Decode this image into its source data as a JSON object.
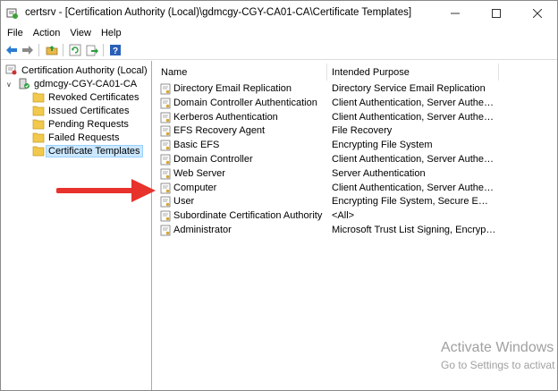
{
  "window": {
    "title": "certsrv - [Certification Authority (Local)\\gdmcgy-CGY-CA01-CA\\Certificate Templates]"
  },
  "menu": [
    {
      "label": "File"
    },
    {
      "label": "Action"
    },
    {
      "label": "View"
    },
    {
      "label": "Help"
    }
  ],
  "tree": {
    "root": "Certification Authority (Local)",
    "ca": "gdmcgy-CGY-CA01-CA",
    "children": [
      {
        "label": "Revoked Certificates"
      },
      {
        "label": "Issued Certificates"
      },
      {
        "label": "Pending Requests"
      },
      {
        "label": "Failed Requests"
      },
      {
        "label": "Certificate Templates",
        "selected": true
      }
    ]
  },
  "list": {
    "columns": [
      "Name",
      "Intended Purpose"
    ],
    "rows": [
      {
        "name": "Directory Email Replication",
        "purpose": "Directory Service Email Replication"
      },
      {
        "name": "Domain Controller Authentication",
        "purpose": "Client Authentication, Server Authentic..."
      },
      {
        "name": "Kerberos Authentication",
        "purpose": "Client Authentication, Server Authentic..."
      },
      {
        "name": "EFS Recovery Agent",
        "purpose": "File Recovery"
      },
      {
        "name": "Basic EFS",
        "purpose": "Encrypting File System"
      },
      {
        "name": "Domain Controller",
        "purpose": "Client Authentication, Server Authentic..."
      },
      {
        "name": "Web Server",
        "purpose": "Server Authentication"
      },
      {
        "name": "Computer",
        "purpose": "Client Authentication, Server Authentic..."
      },
      {
        "name": "User",
        "purpose": "Encrypting File System, Secure Email, Cl..."
      },
      {
        "name": "Subordinate Certification Authority",
        "purpose": "<All>"
      },
      {
        "name": "Administrator",
        "purpose": "Microsoft Trust List Signing, Encrypting..."
      }
    ]
  },
  "watermark": {
    "title": "Activate Windows",
    "subtitle": "Go to Settings to activat"
  },
  "colors": {
    "selection": "#cce8ff",
    "arrow": "#e8322c",
    "folder": "#f2c94c"
  }
}
